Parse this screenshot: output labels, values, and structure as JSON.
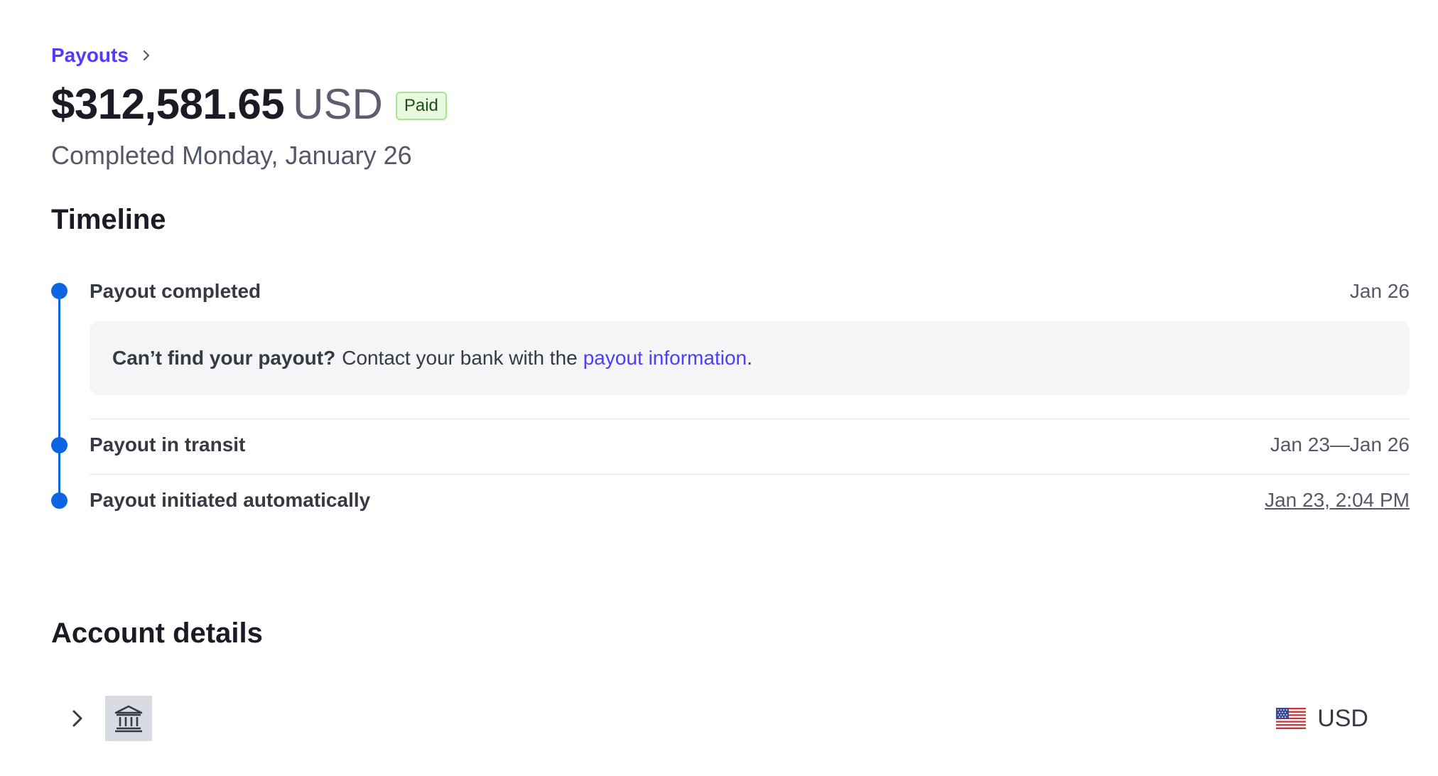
{
  "breadcrumb": {
    "label": "Payouts"
  },
  "payout": {
    "amount": "$312,581.65",
    "currency": "USD",
    "status": "Paid",
    "subtitle": "Completed Monday, January 26"
  },
  "timeline": {
    "title": "Timeline",
    "events": [
      {
        "label": "Payout completed",
        "date": "Jan 26"
      },
      {
        "label": "Payout in transit",
        "date": "Jan 23—Jan 26"
      },
      {
        "label": "Payout initiated automatically",
        "date": "Jan 23, 2:04 PM"
      }
    ],
    "notice": {
      "bold": "Can’t find your payout?",
      "text": "Contact your bank with the",
      "link": "payout information",
      "end": "."
    }
  },
  "account": {
    "title": "Account details",
    "bank_icon": "bank-icon",
    "flag_icon": "us-flag-icon",
    "currency": "USD"
  },
  "colors": {
    "accent": "#533afd",
    "timeline": "#0c66e4",
    "badge_bg": "#e8f9df",
    "badge_border": "#a7e58f"
  }
}
